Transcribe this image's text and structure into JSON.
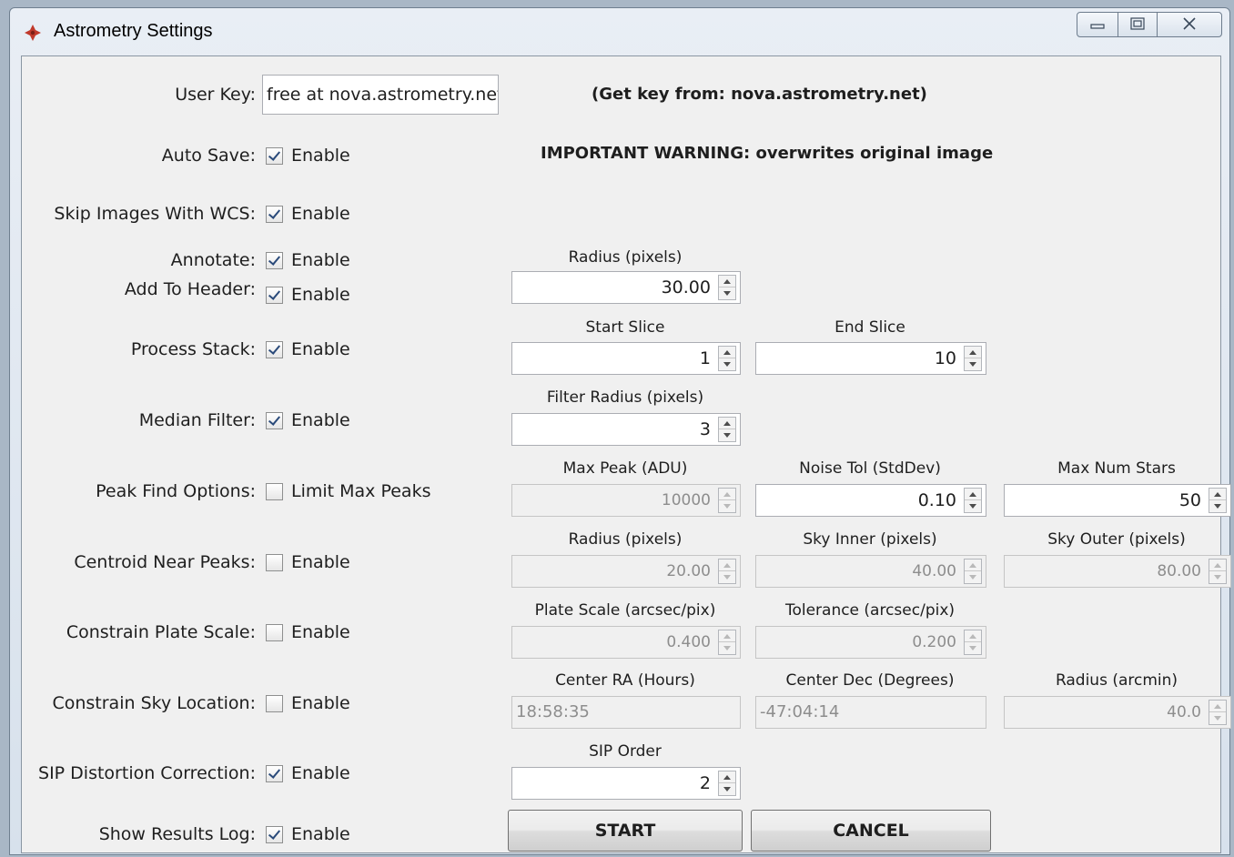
{
  "window": {
    "title": "Astrometry Settings",
    "controls": [
      "minimize-icon",
      "maximize-icon",
      "close-icon"
    ]
  },
  "user_key": {
    "label": "User Key:",
    "value": "free at nova.astrometry.net",
    "hint": "(Get key from:  nova.astrometry.net)"
  },
  "warning": "IMPORTANT WARNING:  overwrites original image",
  "rows": {
    "auto_save": {
      "label": "Auto Save:",
      "checkbox": "Enable",
      "checked": true
    },
    "skip_wcs": {
      "label": "Skip Images With WCS:",
      "checkbox": "Enable",
      "checked": true
    },
    "annotate": {
      "label": "Annotate:",
      "checkbox": "Enable",
      "checked": true
    },
    "add_header": {
      "label": "Add To Header:",
      "checkbox": "Enable",
      "checked": true
    },
    "process_stack": {
      "label": "Process Stack:",
      "checkbox": "Enable",
      "checked": true
    },
    "median_filter": {
      "label": "Median Filter:",
      "checkbox": "Enable",
      "checked": true
    },
    "peak_find": {
      "label": "Peak Find Options:",
      "checkbox": "Limit Max Peaks",
      "checked": false
    },
    "centroid": {
      "label": "Centroid Near Peaks:",
      "checkbox": "Enable",
      "checked": false
    },
    "plate_scale": {
      "label": "Constrain Plate Scale:",
      "checkbox": "Enable",
      "checked": false
    },
    "sky_location": {
      "label": "Constrain Sky Location:",
      "checkbox": "Enable",
      "checked": false
    },
    "sip": {
      "label": "SIP Distortion Correction:",
      "checkbox": "Enable",
      "checked": true
    },
    "results_log": {
      "label": "Show Results Log:",
      "checkbox": "Enable",
      "checked": true
    }
  },
  "fields": {
    "annotate_radius": {
      "title": "Radius (pixels)",
      "value": "30.00"
    },
    "start_slice": {
      "title": "Start Slice",
      "value": "1"
    },
    "end_slice": {
      "title": "End Slice",
      "value": "10"
    },
    "filter_radius": {
      "title": "Filter Radius (pixels)",
      "value": "3"
    },
    "max_peak": {
      "title": "Max Peak (ADU)",
      "value": "10000"
    },
    "noise_tol": {
      "title": "Noise Tol (StdDev)",
      "value": "0.10"
    },
    "max_stars": {
      "title": "Max Num Stars",
      "value": "50"
    },
    "centroid_radius": {
      "title": "Radius (pixels)",
      "value": "20.00"
    },
    "sky_inner": {
      "title": "Sky Inner (pixels)",
      "value": "40.00"
    },
    "sky_outer": {
      "title": "Sky Outer (pixels)",
      "value": "80.00"
    },
    "plate_scale": {
      "title": "Plate Scale (arcsec/pix)",
      "value": "0.400"
    },
    "tolerance": {
      "title": "Tolerance (arcsec/pix)",
      "value": "0.200"
    },
    "center_ra": {
      "title": "Center RA (Hours)",
      "value": "18:58:35"
    },
    "center_dec": {
      "title": "Center Dec (Degrees)",
      "value": "-47:04:14"
    },
    "sky_radius": {
      "title": "Radius (arcmin)",
      "value": "40.0"
    },
    "sip_order": {
      "title": "SIP Order",
      "value": "2"
    }
  },
  "buttons": {
    "start": "START",
    "cancel": "CANCEL"
  }
}
